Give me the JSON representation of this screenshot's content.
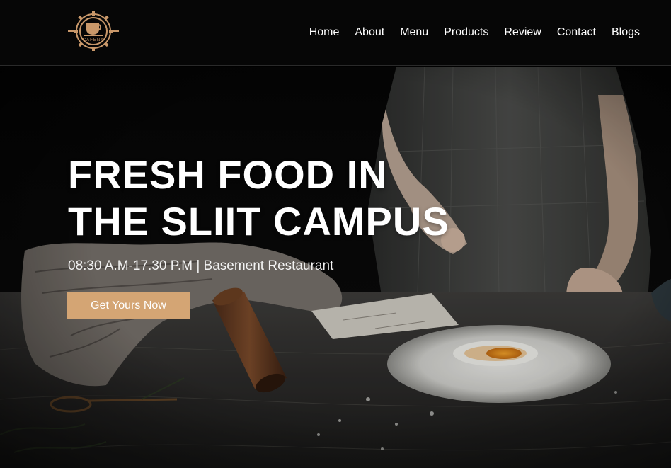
{
  "brand": {
    "logo_text": "CAFENA",
    "logo_icon": "coffee-cup-gear-icon",
    "accent": "#d4a574"
  },
  "nav": {
    "items": [
      {
        "label": "Home"
      },
      {
        "label": "About"
      },
      {
        "label": "Menu"
      },
      {
        "label": "Products"
      },
      {
        "label": "Review"
      },
      {
        "label": "Contact"
      },
      {
        "label": "Blogs"
      }
    ]
  },
  "hero": {
    "title_line1": "FRESH FOOD IN",
    "title_line2": "THE SLIIT CAMPUS",
    "subtitle": "08:30 A.M-17.30 P.M | Basement Restaurant",
    "cta_label": "Get Yours Now",
    "cta_color": "#d4a574"
  }
}
